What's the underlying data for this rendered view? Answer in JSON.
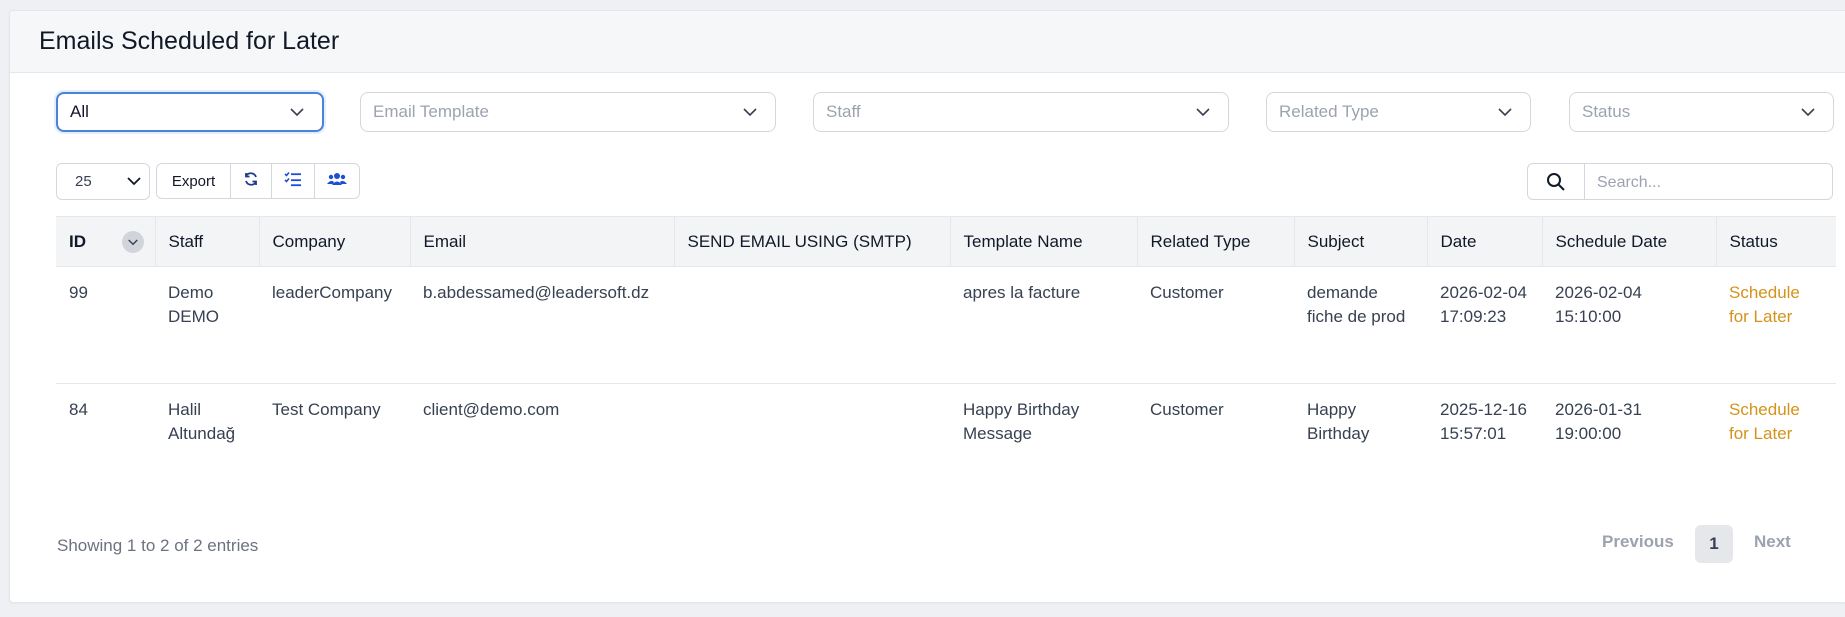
{
  "header": {
    "title": "Emails Scheduled for Later"
  },
  "filters": {
    "scope": {
      "value": "All"
    },
    "email_template": {
      "placeholder": "Email Template"
    },
    "staff": {
      "placeholder": "Staff"
    },
    "related_type": {
      "placeholder": "Related Type"
    },
    "status": {
      "placeholder": "Status"
    }
  },
  "toolbar": {
    "page_size": "25",
    "export_label": "Export",
    "refresh_icon": "refresh-icon",
    "bulk_icon": "checklist-icon",
    "users_icon": "users-icon"
  },
  "search": {
    "placeholder": "Search..."
  },
  "table": {
    "columns": [
      "ID",
      "Staff",
      "Company",
      "Email",
      "SEND EMAIL USING (SMTP)",
      "Template Name",
      "Related Type",
      "Subject",
      "Date",
      "Schedule Date",
      "Status"
    ],
    "rows": [
      {
        "id": "99",
        "staff": "Demo DEMO",
        "company": "leaderCompany",
        "email": "b.abdessamed@leadersoft.dz",
        "smtp": "",
        "template": "apres la facture",
        "related_type": "Customer",
        "subject": "demande fiche de prod",
        "date": "2026-02-04 17:09:23",
        "schedule_date": "2026-02-04 15:10:00",
        "status": "Schedule for Later"
      },
      {
        "id": "84",
        "staff": "Halil Altundağ",
        "company": "Test Company",
        "email": "client@demo.com",
        "smtp": "",
        "template": "Happy Birthday Message",
        "related_type": "Customer",
        "subject": "Happy Birthday",
        "date": "2025-12-16 15:57:01",
        "schedule_date": "2026-01-31 19:00:00",
        "status": "Schedule for Later"
      }
    ]
  },
  "footer": {
    "info": "Showing 1 to 2 of 2 entries",
    "previous": "Previous",
    "current_page": "1",
    "next": "Next"
  },
  "colors": {
    "status": "#d4931a",
    "accent": "#4a84d9",
    "icon_blue": "#1d4ed8"
  }
}
